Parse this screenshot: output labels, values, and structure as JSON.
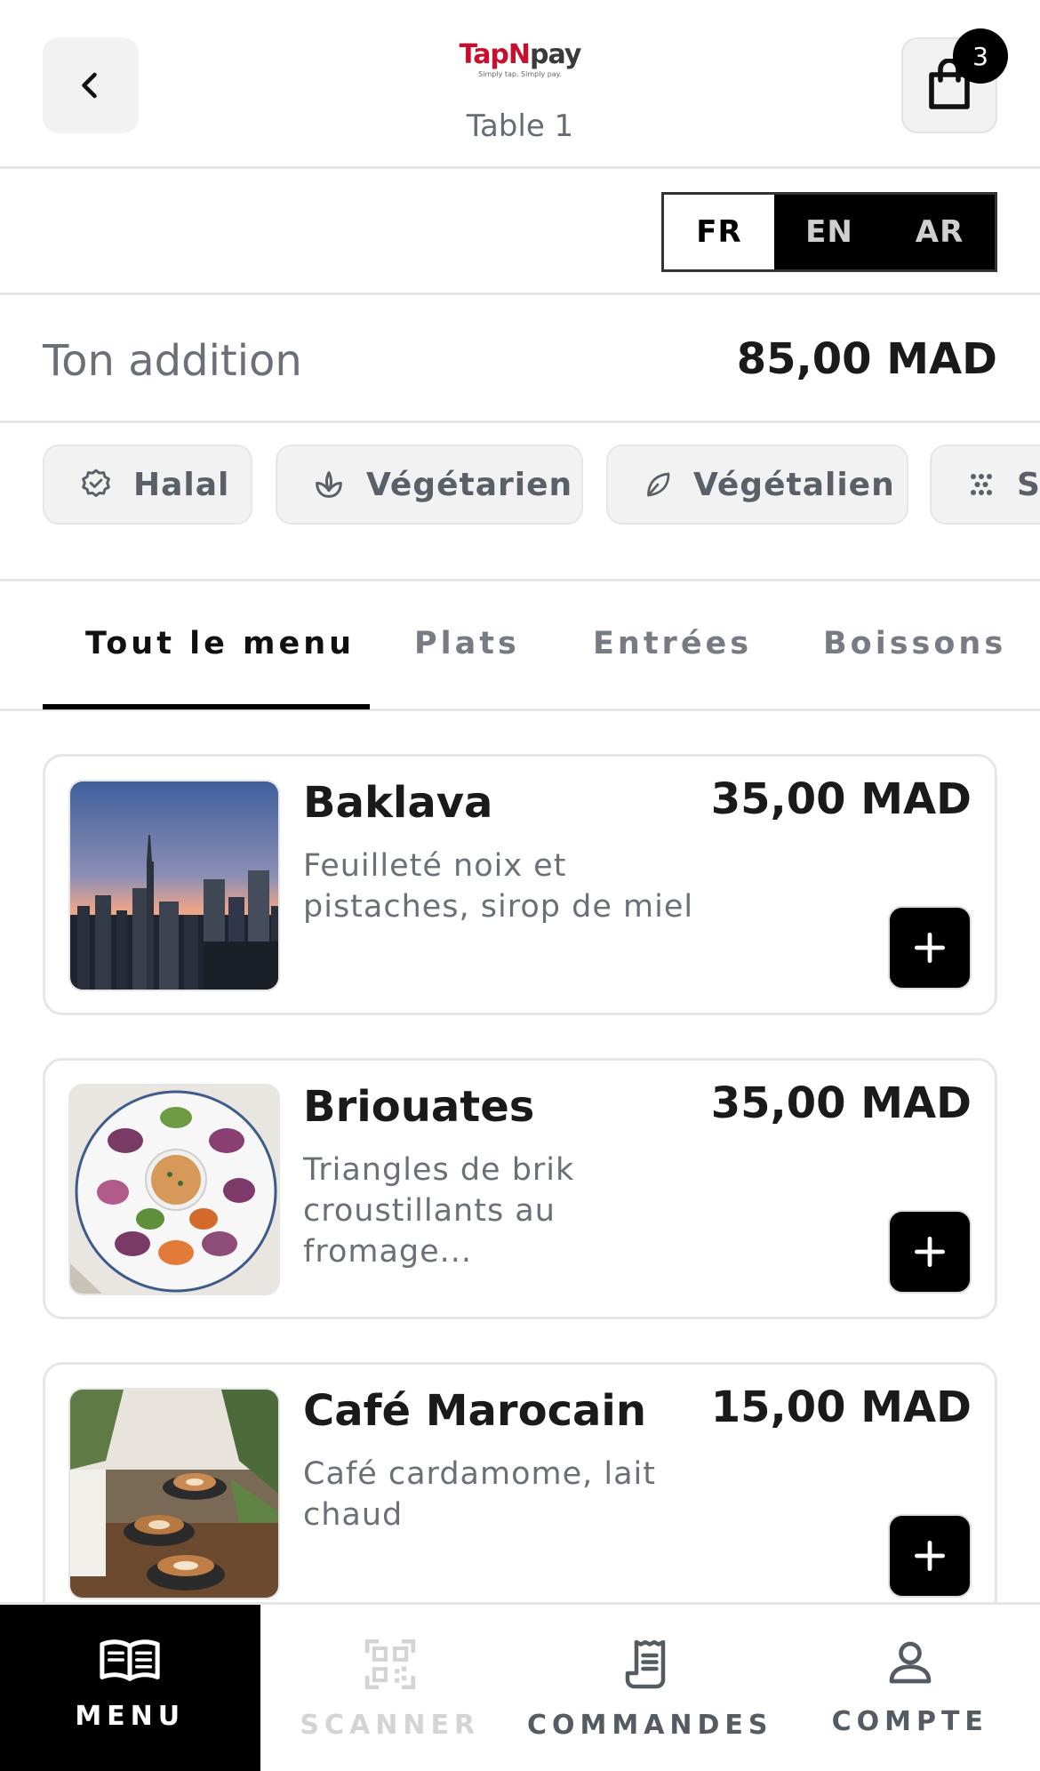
{
  "header": {
    "back_icon": "chevron-left-icon",
    "logo_text_tap": "Tap",
    "logo_text_n": "N",
    "logo_text_pay": "pay",
    "logo_tagline": "Simply tap. Simply pay.",
    "table_label": "Table 1",
    "cart_icon": "shopping-bag-icon",
    "cart_count": "3"
  },
  "languages": {
    "options": [
      "FR",
      "EN",
      "AR"
    ],
    "selected": "FR"
  },
  "bill": {
    "label": "Ton addition",
    "amount": "85,00 MAD"
  },
  "filters": [
    {
      "label": "Halal",
      "icon": "badge-check-icon"
    },
    {
      "label": "Végétarien",
      "icon": "sprout-icon"
    },
    {
      "label": "Végétalien",
      "icon": "leaf-icon"
    },
    {
      "label": "S",
      "icon": "dots-grid-icon"
    }
  ],
  "tabs": [
    {
      "label": "Tout le menu",
      "active": true
    },
    {
      "label": "Plats",
      "active": false
    },
    {
      "label": "Entrées",
      "active": false
    },
    {
      "label": "Boissons",
      "active": false
    }
  ],
  "menu_items": [
    {
      "name": "Baklava",
      "description": "Feuilleté noix et pistaches, sirop de miel",
      "price": "35,00 MAD",
      "image": "city-skyline-photo"
    },
    {
      "name": "Briouates",
      "description": "Triangles de brik croustillants au fromage...",
      "price": "35,00 MAD",
      "image": "spring-rolls-photo"
    },
    {
      "name": "Café Marocain",
      "description": "Café cardamome, lait chaud",
      "price": "15,00 MAD",
      "image": "coffee-cups-photo"
    }
  ],
  "bottom_nav": [
    {
      "label": "MENU",
      "icon": "open-book-icon",
      "active": true
    },
    {
      "label": "SCANNER",
      "icon": "qr-code-icon",
      "active": false,
      "disabled": true
    },
    {
      "label": "COMMANDES",
      "icon": "receipt-icon",
      "active": false
    },
    {
      "label": "COMPTE",
      "icon": "user-icon",
      "active": false
    }
  ],
  "colors": {
    "brand_red": "#c8102e",
    "primary": "#000000",
    "muted_text": "#6b7078",
    "border": "#e6e6e6",
    "chip_bg": "#f2f2f2"
  }
}
